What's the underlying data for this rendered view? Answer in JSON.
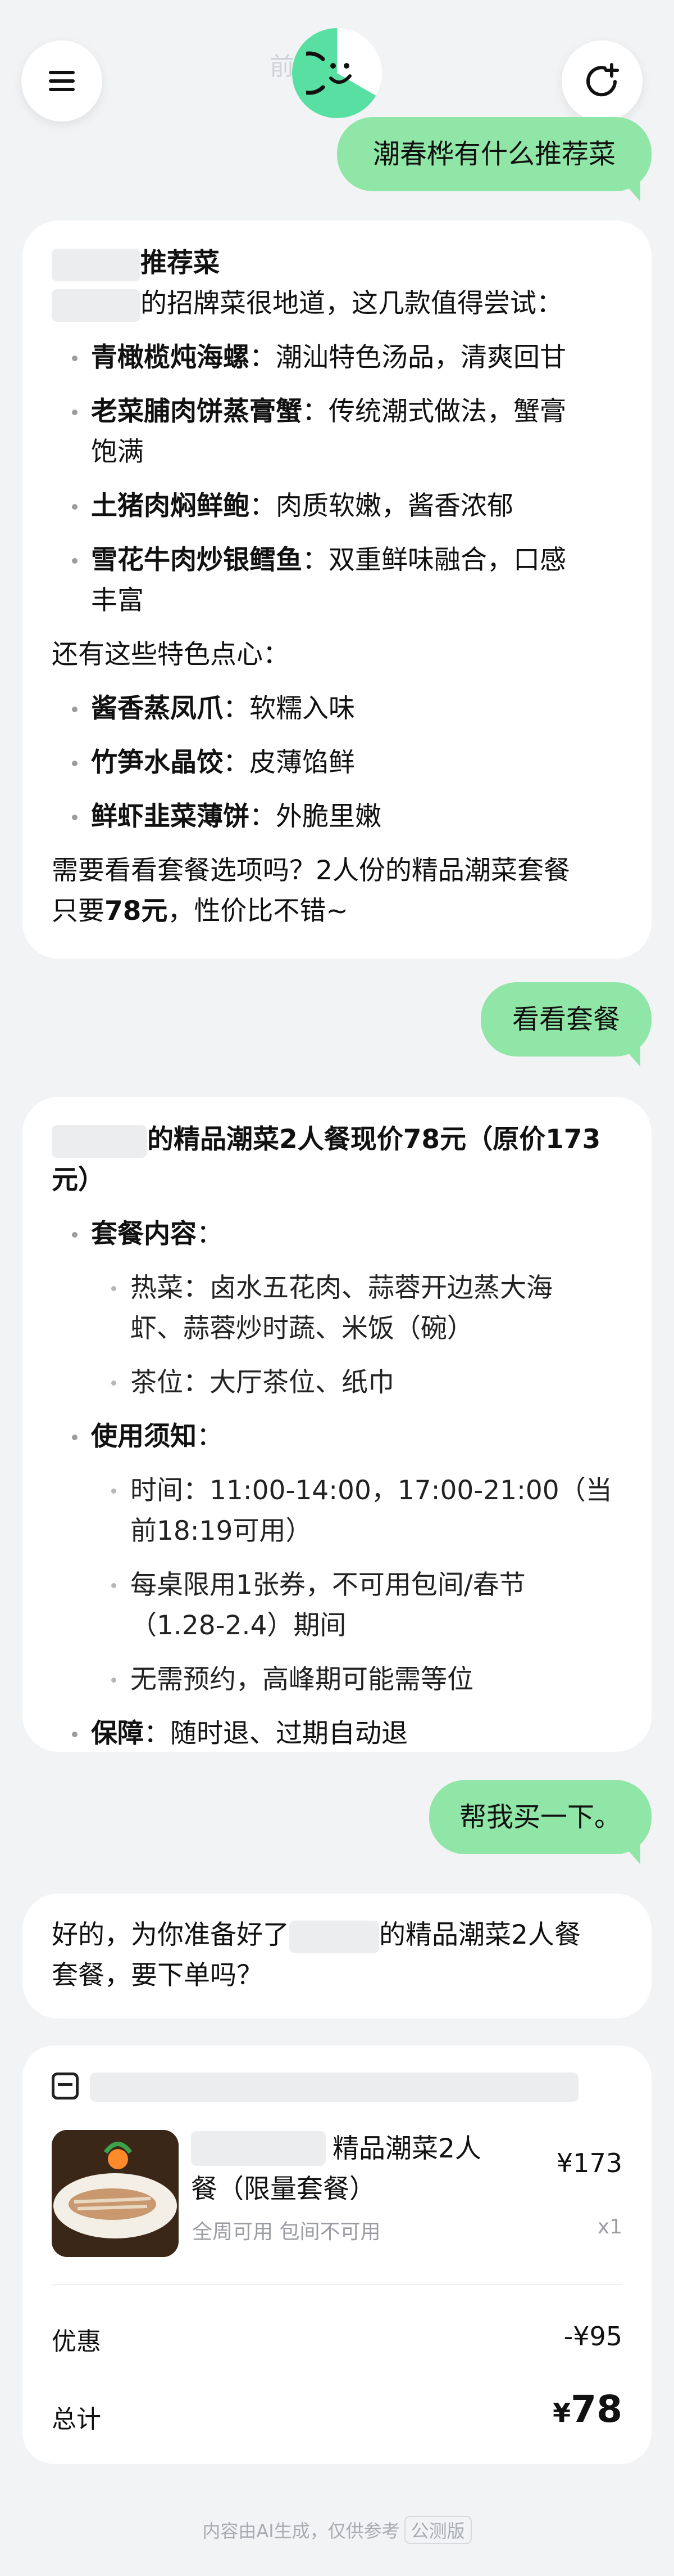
{
  "header": {
    "time_text": "前18:18",
    "menu_icon": "hamburger-icon",
    "new_chat_icon": "new-chat-icon"
  },
  "messages": {
    "user_1": "潮春桦有什么推荐菜",
    "reply_1": {
      "heading": "推荐菜",
      "intro": "的招牌菜很地道，这几款值得尝试：",
      "dishes": [
        {
          "name": "青橄榄炖海螺",
          "desc": "：潮汕特色汤品，清爽回甘"
        },
        {
          "name": "老菜脯肉饼蒸膏蟹",
          "desc": "：传统潮式做法，蟹膏",
          "desc2": "饱满"
        },
        {
          "name": "土猪肉焖鲜鲍",
          "desc": "：肉质软嫩，酱香浓郁"
        },
        {
          "name": "雪花牛肉炒银鳕鱼",
          "desc": "：双重鲜味融合，口感",
          "desc2": "丰富"
        }
      ],
      "snack_intro": "还有这些特色点心：",
      "snacks": [
        {
          "name": "酱香蒸凤爪",
          "desc": "：软糯入味"
        },
        {
          "name": "竹笋水晶饺",
          "desc": "：皮薄馅鲜"
        },
        {
          "name": "鲜虾韭菜薄饼",
          "desc": "：外脆里嫩"
        }
      ],
      "closing_1": "需要看看套餐选项吗？2人份的精品潮菜套餐",
      "closing_2a": "只要",
      "closing_2b": "78元",
      "closing_2c": "，性价比不错~"
    },
    "user_2": "看看套餐",
    "reply_2": {
      "title_1": "的精品潮菜2人餐现价78元（原价173",
      "title_2": "元）",
      "content_label": "套餐内容",
      "colon": "：",
      "hot_1": "热菜：卤水五花肉、蒜蓉开边蒸大海",
      "hot_2": "虾、蒜蓉炒时蔬、米饭（碗）",
      "tea": "茶位：大厅茶位、纸巾",
      "rules_label": "使用须知",
      "time_1": "时间：11:00-14:00，17:00-21:00（当",
      "time_2": "前18:19可用）",
      "limit_1": "每桌限用1张券，不可用包间/春节",
      "limit_2": "（1.28-2.4）期间",
      "booking": "无需预约，高峰期可能需等位",
      "guarantee_label": "保障",
      "guarantee": "：随时退、过期自动退"
    },
    "user_3": "帮我买一下。",
    "reply_3": {
      "line_1a": "好的，为你准备好了",
      "line_1b": "的精品潮菜2人餐",
      "line_2": "套餐，要下单吗？"
    }
  },
  "order": {
    "store_icon": "store-icon",
    "product_name_1": "精品潮菜2人",
    "product_name_2": "餐（限量套餐）",
    "product_tags": "全周可用 包间不可用",
    "price": "¥173",
    "quantity": "x1",
    "discount_label": "优惠",
    "discount_value": "-¥95",
    "total_label": "总计",
    "total_currency": "¥",
    "total_value": "78"
  },
  "footer": {
    "note": "内容由AI生成，仅供参考",
    "badge": "公测版"
  },
  "colors": {
    "user_bubble": "#8fe6a6",
    "background": "#f2f3f5",
    "avatar_accent": "#57e0a2"
  }
}
